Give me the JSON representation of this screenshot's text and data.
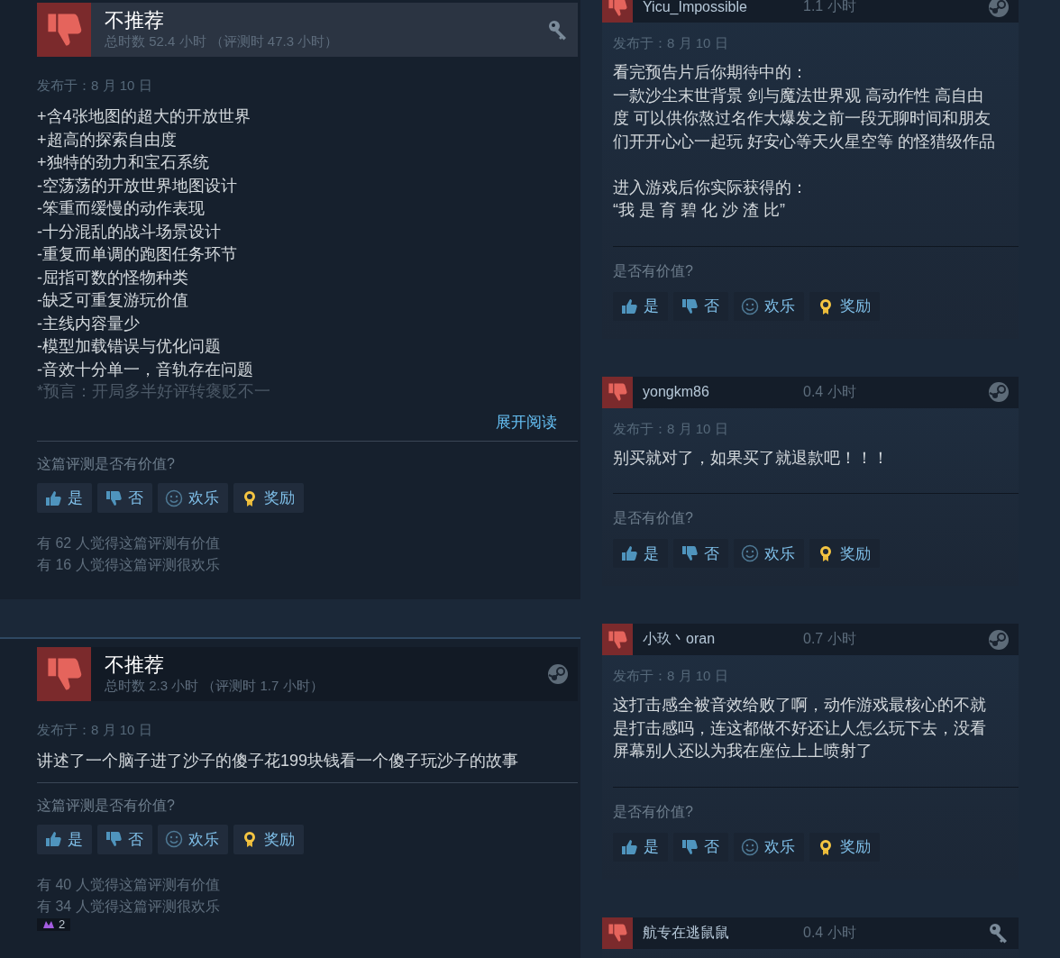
{
  "left_reviews": [
    {
      "verdict": "不推荐",
      "hours": "总时数 52.4 小时 （评测时 47.3 小时）",
      "kind": "key",
      "highlighted": true,
      "posted": "发布于：8 月 10 日",
      "lines": [
        "+含4张地图的超大的开放世界",
        "+超高的探索自由度",
        "+独特的劲力和宝石系统",
        "-空荡荡的开放世界地图设计",
        "-笨重而缓慢的动作表现",
        "-十分混乱的战斗场景设计",
        "-重复而单调的跑图任务环节",
        "-屈指可数的怪物种类",
        "-缺乏可重复游玩价值",
        "-主线内容量少",
        "-模型加载错误与优化问题",
        "-音效十分单一，音轨存在问题"
      ],
      "faded_line": "*预言：开局多半好评转褒贬不一",
      "read_more": "展开阅读",
      "question": "这篇评测是否有价值?",
      "buttons": [
        {
          "kind": "yes",
          "label": "是"
        },
        {
          "kind": "no",
          "label": "否"
        },
        {
          "kind": "funny",
          "label": "欢乐"
        },
        {
          "kind": "award",
          "label": "奖励"
        }
      ],
      "stats": [
        "有 62 人觉得这篇评测有价值",
        "有 16 人觉得这篇评测很欢乐"
      ]
    },
    {
      "verdict": "不推荐",
      "hours": "总时数 2.3 小时 （评测时 1.7 小时）",
      "kind": "steam",
      "highlighted": false,
      "posted": "发布于：8 月 10 日",
      "lines": [
        "讲述了一个脑子进了沙子的傻子花199块钱看一个傻子玩沙子的故事"
      ],
      "question": "这篇评测是否有价值?",
      "buttons": [
        {
          "kind": "yes",
          "label": "是"
        },
        {
          "kind": "no",
          "label": "否"
        },
        {
          "kind": "funny",
          "label": "欢乐"
        },
        {
          "kind": "award",
          "label": "奖励"
        }
      ],
      "stats": [
        "有 40 人觉得这篇评测有价值",
        "有 34 人觉得这篇评测很欢乐"
      ],
      "awards": [
        {
          "count": "2"
        }
      ]
    }
  ],
  "right_reviews": [
    {
      "user": "Yicu_Impossible",
      "hours": "1.1 小时",
      "kind": "steam",
      "posted": "发布于：8 月 10 日",
      "paragraphs": [
        [
          "看完预告片后你期待中的：",
          "一款沙尘末世背景 剑与魔法世界观 高动作性 高自由度 可以供你熬过名作大爆发之前一段无聊时间和朋友们开开心心一起玩 好安心等天火星空等 的怪猎级作品"
        ],
        [
          "进入游戏后你实际获得的：",
          "“我 是 育 碧 化 沙 渣 比”"
        ]
      ],
      "question": "是否有价值?",
      "buttons": [
        {
          "kind": "yes",
          "label": "是"
        },
        {
          "kind": "no",
          "label": "否"
        },
        {
          "kind": "funny",
          "label": "欢乐"
        },
        {
          "kind": "award",
          "label": "奖励"
        }
      ]
    },
    {
      "user": "yongkm86",
      "hours": "0.4 小时",
      "kind": "steam",
      "posted": "发布于：8 月 10 日",
      "paragraphs": [
        [
          "别买就对了，如果买了就退款吧！！！"
        ]
      ],
      "question": "是否有价值?",
      "buttons": [
        {
          "kind": "yes",
          "label": "是"
        },
        {
          "kind": "no",
          "label": "否"
        },
        {
          "kind": "funny",
          "label": "欢乐"
        },
        {
          "kind": "award",
          "label": "奖励"
        }
      ]
    },
    {
      "user": "小玖丶oran",
      "hours": "0.7 小时",
      "kind": "steam",
      "posted": "发布于：8 月 10 日",
      "paragraphs": [
        [
          "这打击感全被音效给败了啊，动作游戏最核心的不就是打击感吗，连这都做不好还让人怎么玩下去，没看屏幕别人还以为我在座位上上喷射了"
        ]
      ],
      "question": "是否有价值?",
      "buttons": [
        {
          "kind": "yes",
          "label": "是"
        },
        {
          "kind": "no",
          "label": "否"
        },
        {
          "kind": "funny",
          "label": "欢乐"
        },
        {
          "kind": "award",
          "label": "奖励"
        }
      ]
    },
    {
      "user": "航专在逃鼠鼠",
      "hours": "0.4 小时",
      "kind": "key"
    }
  ]
}
